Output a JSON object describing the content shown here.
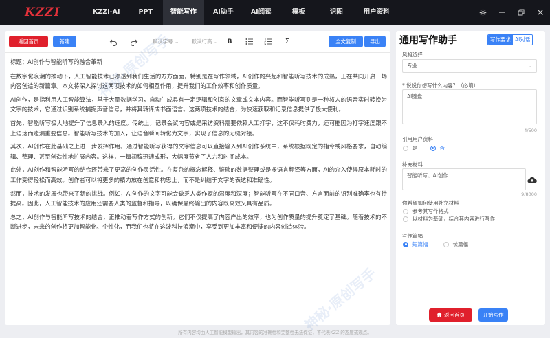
{
  "app": {
    "logo_text": "KZZI",
    "nav": [
      "KZZI-AI",
      "PPT",
      "智能写作",
      "AI助手",
      "AI阅读",
      "模板",
      "识图",
      "用户资料"
    ],
    "nav_active_index": 2,
    "accent_color": "#3a82f6",
    "danger_color": "#e0202c"
  },
  "toolbar": {
    "back_home": "返回首页",
    "new_doc": "新建",
    "font_size": "默认字号",
    "line_height": "默认行高",
    "bold_icon": "B",
    "formula_icon": "Σ",
    "copy_all": "全文复制",
    "export": "导出"
  },
  "article": {
    "title_line": "标题：AI创作与智能听写的融合革新",
    "paragraphs": [
      "在数字化浪潮的推动下，人工智能技术已渗透到我们生活的方方面面，特别是在写作领域，AI创作的兴起和智能听写技术的成熟，正在共同开启一场内容创造的新篇章。本文将深入探讨这两项技术的如何相互作用，提升我们的工作效率和创作质量。",
      "AI创作，是指利用人工智能算法，基于大量数据学习，自动生成具有一定逻辑和创意的文章或文本内容。而智能听写则是一种将人的语音实时转换为文字的技术，它通过识别系统捕捉声音信号，并将其转译成书面语言。这两项技术的结合，为快速获取和记录信息提供了极大便利。",
      "首先，智能听写极大地提升了信息录入的速度。传统上，记录会议内容或是采访资料需要依赖人工打字，这不仅耗时费力，还可能因为打字速度跟不上语速而遗漏重要信息。智能听写技术的加入，让语音瞬间转化为文字，实现了信息的无缝对接。",
      "其次，AI创作在此基础之上进一步发挥作用。通过智能听写获得的文字信息可以直接输入到AI创作系统中，系统根据既定的指令或风格要求，自动编辑、整理、甚至创造性地扩展内容。这样，一篇初稿迅速成形，大幅度节省了人力和时间成本。",
      "此外，AI创作和智能听写的结合还带来了更高的创作灵活性。在复杂的概念解释、繁琐的数据整理或是多语言翻译等方面，AI的介入使得原本耗时的工作变得轻松而高效。创作者可以将更多的精力放在创意和构思上，而不是纠结于文字的表达和准确性。",
      "然而，技术的发展也带来了新的挑战。例如，AI创作的文字可能会缺乏人类作家的温度和深度；智能听写在不同口音、方言面前的识别准确率也有待提高。因此，人工智能技术的应用还需要人类的监督和指导，以确保最终输出的内容既高效又具有品质。",
      "总之，AI创作与智能听写技术的结合，正推动着写作方式的创新。它们不仅提高了内容产出的效率，也为创作质量的提升奠定了基础。随着技术的不断进步，未来的创作将更加智能化、个性化，而我们也将在这波科技浪潮中，享受到更加丰富和便捷的内容创造体验。"
    ]
  },
  "panel": {
    "title": "通用写作助手",
    "tab_active": "写作要求",
    "tab_other": "AI对话",
    "style_label": "风格选择",
    "style_value": "专业",
    "prompt_label": "* 说说你想写什么内容？（必填）",
    "prompt_value": "AI键盘",
    "prompt_count": "4/500",
    "ref_user_label": "引用用户资料",
    "ref_yes": "是",
    "ref_no": "否",
    "supplement_label": "补充材料",
    "supplement_value": "智能听写、AI创作",
    "supplement_count": "9/8000",
    "usage_label": "你希望如何使用补充材料",
    "usage_opt1": "参考其写作格式",
    "usage_opt2": "以材料为基础，结合其内容进行写作",
    "length_label": "写作篇幅",
    "length_short": "短篇幅",
    "length_long": "长篇幅",
    "back_home": "返回首页",
    "start": "开始写作"
  },
  "footer_text": "所有内容均由人工智能模型输出，其内容的准确性和完整性无法保证，不代表KZZI的态度或观点。",
  "watermark": "神秘·原创写手"
}
